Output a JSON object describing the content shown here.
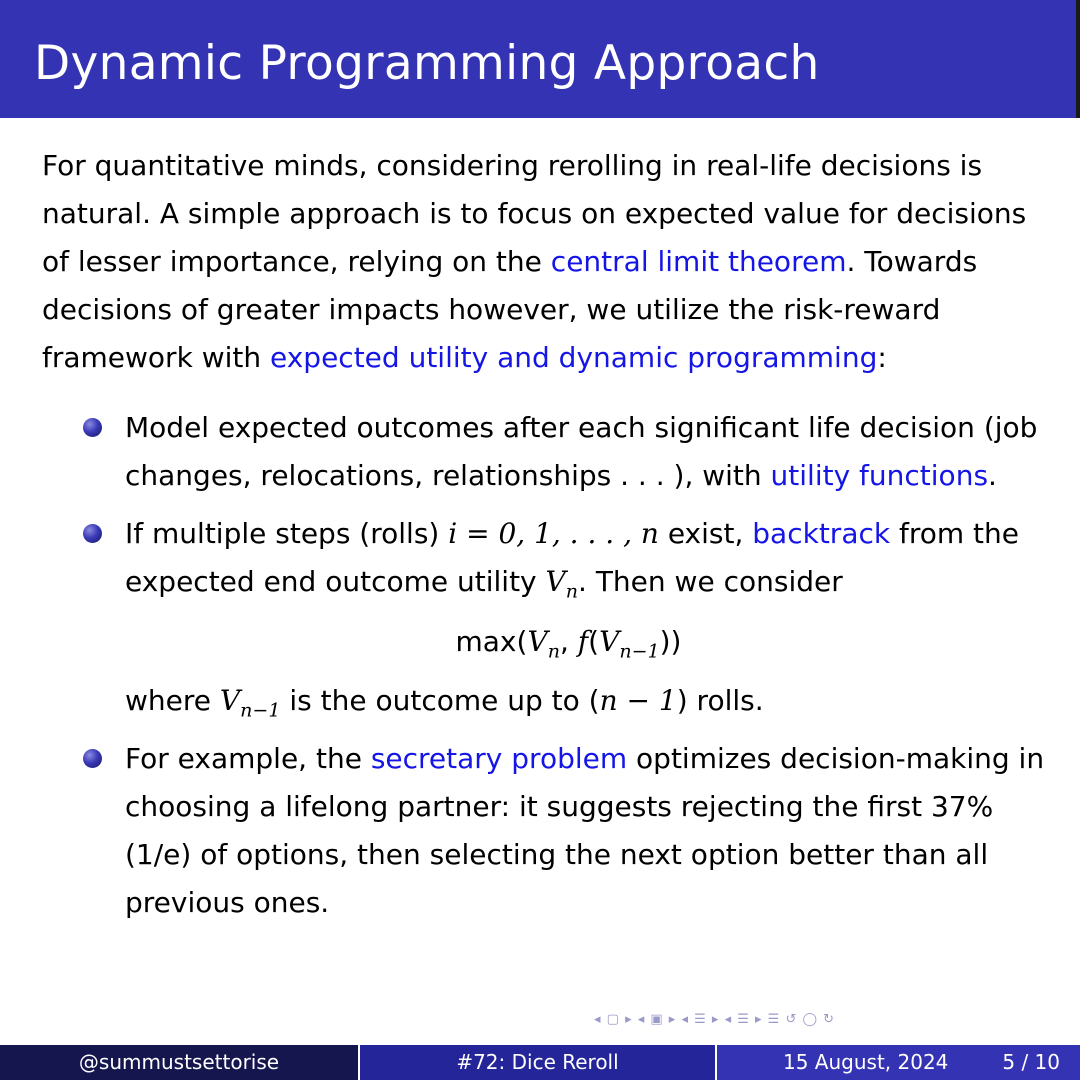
{
  "slide": {
    "title": "Dynamic Programming Approach",
    "intro": {
      "text1": "For quantitative minds, considering rerolling in real-life decisions is natural. A simple approach is to focus on expected value for decisions of lesser importance, relying on the ",
      "link1": "central limit theorem",
      "text2": ". Towards decisions of greater impacts however, we utilize the risk-reward framework with ",
      "link2": "expected utility and dynamic programming",
      "text3": ":"
    },
    "bullets": [
      {
        "text1": "Model expected outcomes after each significant life decision (job changes, relocations, relationships . . . ), with ",
        "link": "utility functions",
        "text2": "."
      },
      {
        "text1": "If multiple steps (rolls) ",
        "math1": "i = 0, 1, . . . , n",
        "text2": " exist, ",
        "link": "backtrack",
        "text3": " from the expected end outcome utility ",
        "vn_base": "V",
        "vn_sub": "n",
        "text4": ". Then we consider",
        "equation": {
          "fn": "max",
          "open": "(",
          "v": "V",
          "sub_n": "n",
          "comma": ", ",
          "f": "f",
          "open2": "(",
          "sub_n1": "n−1",
          "close": "))"
        },
        "where_text1": "where ",
        "where_sub": "n−1",
        "where_text2": " is the outcome up to (",
        "where_math": "n − 1",
        "where_text3": ") rolls."
      },
      {
        "text1": "For example, the ",
        "link": "secretary problem",
        "text2": " optimizes decision-making in choosing a lifelong partner: it suggests rejecting the first 37% (1/e) of options, then selecting the next option better than all previous ones."
      }
    ]
  },
  "navigation": {
    "symbols": "◂ ▢ ▸  ◂ ▣ ▸  ◂ ☰ ▸  ◂ ☰ ▸   ☰   ↺ ◯ ↻"
  },
  "footer": {
    "author": "@summustsettorise",
    "talk_title": "#72: Dice Reroll",
    "date": "15 August, 2024",
    "page": "5 / 10"
  },
  "colors": {
    "title_bar": "#3333b3",
    "link": "#1515e6",
    "footer_left": "#16164f",
    "footer_mid": "#25259a",
    "footer_right": "#3333b3"
  }
}
